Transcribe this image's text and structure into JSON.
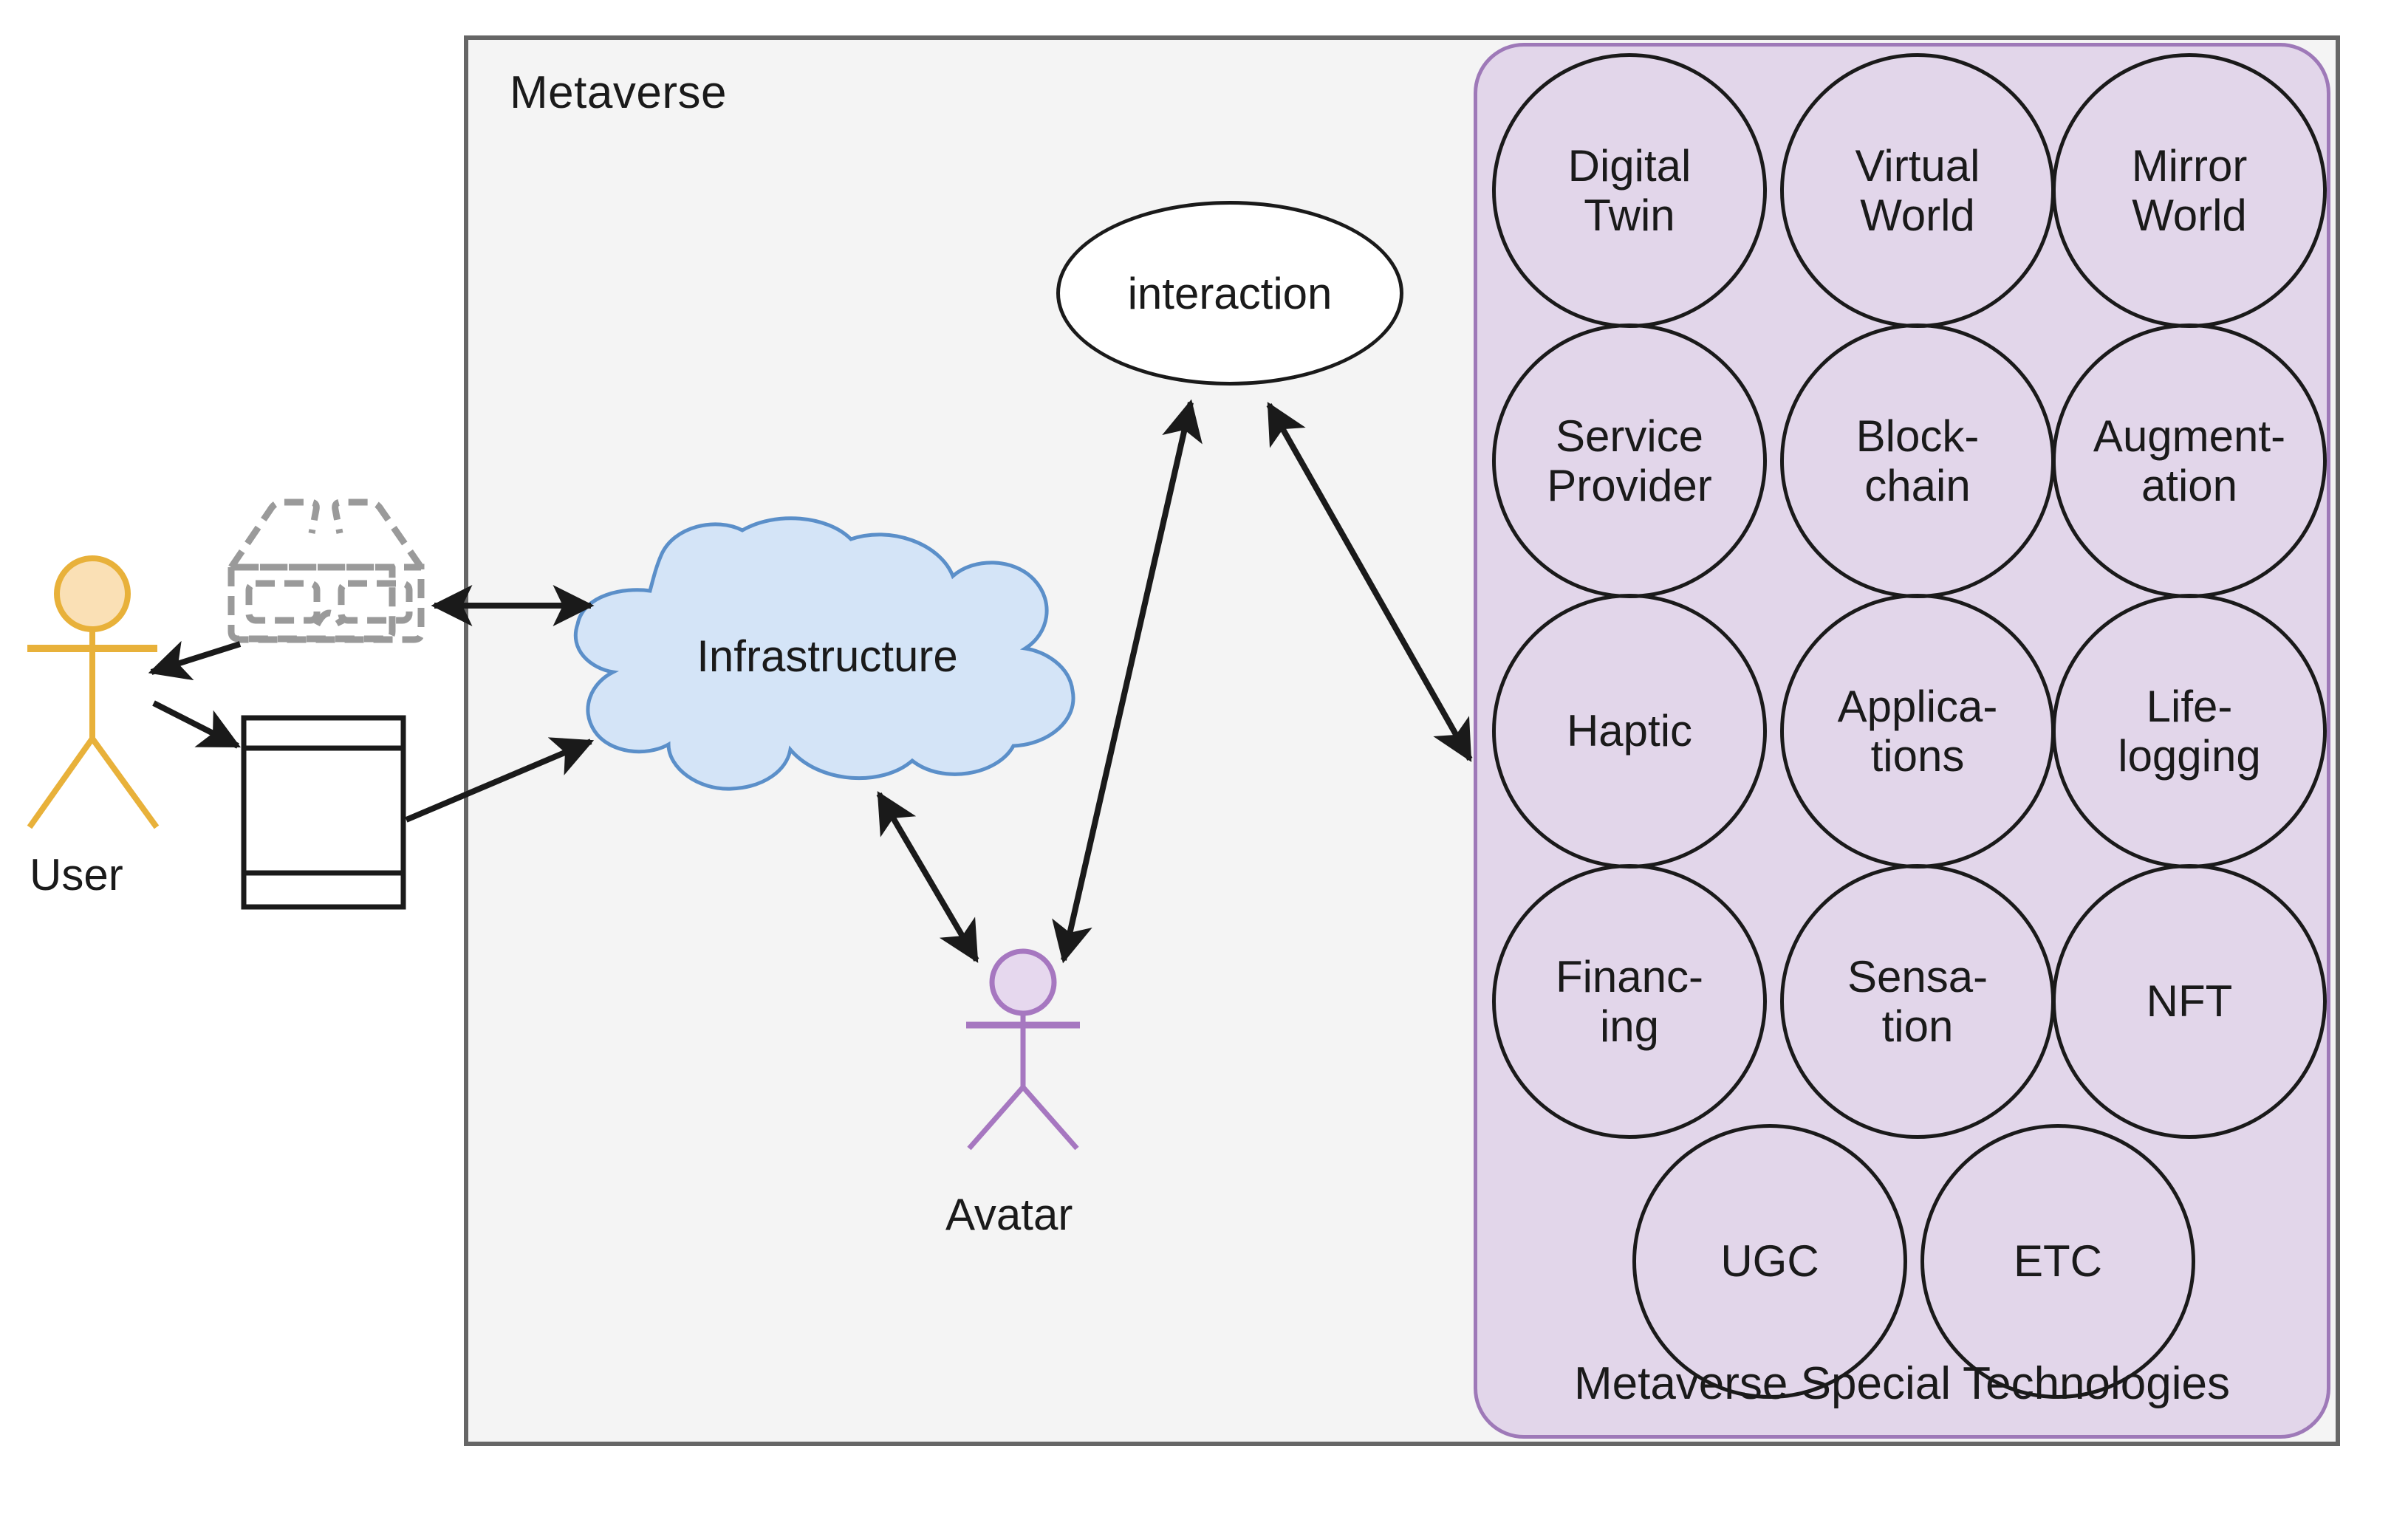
{
  "diagram": {
    "title": "Metaverse",
    "tech_panel_caption": "Metaverse Special Technologies",
    "interaction_label": "interaction",
    "infrastructure_label": "Infrastructure",
    "user_label": "User",
    "avatar_label": "Avatar",
    "technologies": [
      {
        "line1": "Digital",
        "line2": "Twin"
      },
      {
        "line1": "Virtual",
        "line2": "World"
      },
      {
        "line1": "Mirror",
        "line2": "World"
      },
      {
        "line1": "Service",
        "line2": "Provider"
      },
      {
        "line1": "Block-",
        "line2": "chain"
      },
      {
        "line1": "Augment-",
        "line2": "ation"
      },
      {
        "line1": "Haptic",
        "line2": ""
      },
      {
        "line1": "Applica-",
        "line2": "tions"
      },
      {
        "line1": "Life-",
        "line2": "logging"
      },
      {
        "line1": "Financ-",
        "line2": "ing"
      },
      {
        "line1": "Sensa-",
        "line2": "tion"
      },
      {
        "line1": "NFT",
        "line2": ""
      },
      {
        "line1": "UGC",
        "line2": ""
      },
      {
        "line1": "ETC",
        "line2": ""
      }
    ],
    "icons": {
      "vr_glasses": "vr-glasses-icon",
      "mobile_device": "mobile-device-icon",
      "user_actor": "user-actor-icon",
      "avatar_actor": "avatar-actor-icon",
      "cloud": "cloud-icon"
    },
    "colors": {
      "metaverse_fill": "#f4f4f4",
      "metaverse_border": "#666666",
      "tech_panel_fill": "#e2d6ea",
      "tech_panel_border": "#9e79b8",
      "cloud_fill": "#d4e4f7",
      "cloud_border": "#5b8fc9",
      "user_stroke": "#e8b13a",
      "user_head_fill": "#fae0b5",
      "avatar_stroke": "#a677c0",
      "avatar_head_fill": "#e6d8ee",
      "glasses_stroke": "#9a9a9a",
      "arrow_color": "#1a1a1a",
      "text_color": "#1a1a1a"
    },
    "connections": [
      {
        "from": "vr-glasses-icon",
        "to": "user-actor-icon",
        "type": "single"
      },
      {
        "from": "vr-glasses-icon",
        "to": "cloud-icon",
        "type": "double"
      },
      {
        "from": "user-actor-icon",
        "to": "mobile-device-icon",
        "type": "single"
      },
      {
        "from": "mobile-device-icon",
        "to": "cloud-icon",
        "type": "single"
      },
      {
        "from": "cloud-icon",
        "to": "avatar-actor-icon",
        "type": "double"
      },
      {
        "from": "avatar-actor-icon",
        "to": "interaction",
        "type": "double"
      },
      {
        "from": "interaction",
        "to": "tech-panel",
        "type": "double"
      }
    ]
  }
}
